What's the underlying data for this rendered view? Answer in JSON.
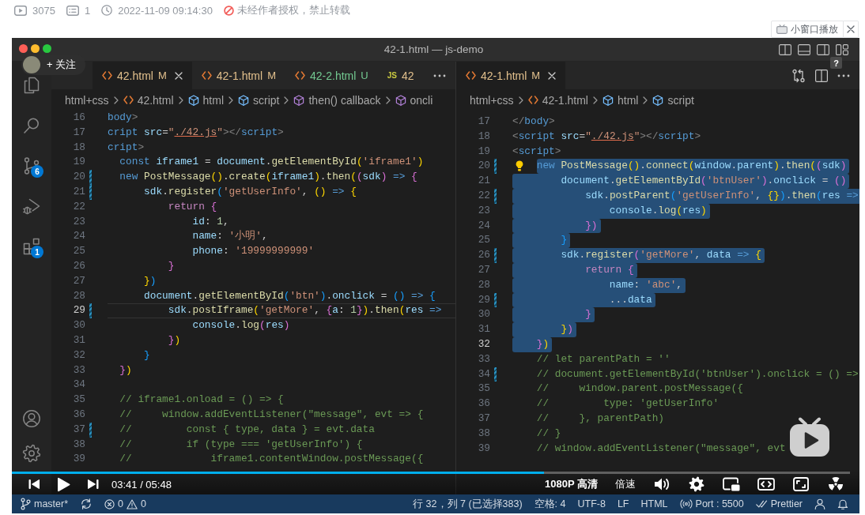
{
  "stats": {
    "plays": "3075",
    "comments": "1",
    "published": "2022-11-09 09:14:30",
    "notice": "未经作者授权，禁止转载"
  },
  "mini_player_button": {
    "label": "小窗口播放"
  },
  "video": {
    "window": {
      "title": "42-1.html — js-demo"
    },
    "follow_button": {
      "label": "+ 关注"
    },
    "help_badge": {
      "label": "?"
    },
    "activity_bar": {
      "source_control_badge": "6",
      "extensions_badge": "1"
    },
    "editors": [
      {
        "tabs": [
          {
            "label": "42.html",
            "status": "M",
            "kind": "html",
            "color": "#e2c08d",
            "selected": true
          },
          {
            "label": "42-1.html",
            "status": "M",
            "kind": "html",
            "color": "#e2c08d",
            "selected": false
          },
          {
            "label": "42-2.html",
            "status": "U",
            "kind": "html",
            "color": "#73c991",
            "selected": false
          },
          {
            "label": "42",
            "icon_text": "JS",
            "kind": "js",
            "color": "#e2c08d",
            "selected": false
          }
        ],
        "breadcrumbs": [
          {
            "label": "html+css",
            "kind": "folder"
          },
          {
            "label": "42.html",
            "kind": "file"
          },
          {
            "label": "html",
            "kind": "element"
          },
          {
            "label": "script",
            "kind": "element"
          },
          {
            "label": "then() callback",
            "kind": "method"
          },
          {
            "label": "oncli",
            "kind": "method"
          }
        ],
        "lines": [
          {
            "number": "16",
            "modified": false,
            "current": false,
            "tokens": [
              {
                "text": "body",
                "kind": "tag"
              },
              {
                "text": ">",
                "kind": "angle"
              }
            ]
          },
          {
            "number": "17",
            "modified": false,
            "current": false,
            "tokens": [
              {
                "text": "cript",
                "kind": "tag"
              },
              {
                "text": " src",
                "kind": "attr"
              },
              {
                "text": "=",
                "kind": "plain"
              },
              {
                "text": "\"",
                "kind": "string"
              },
              {
                "text": "./42.js",
                "kind": "link"
              },
              {
                "text": "\"",
                "kind": "string"
              },
              {
                "text": "></",
                "kind": "angle"
              },
              {
                "text": "script",
                "kind": "tag"
              },
              {
                "text": ">",
                "kind": "angle"
              }
            ]
          },
          {
            "number": "18",
            "modified": false,
            "current": false,
            "tokens": [
              {
                "text": "cript",
                "kind": "tag"
              },
              {
                "text": ">",
                "kind": "angle"
              }
            ]
          },
          {
            "number": "19",
            "modified": false,
            "current": false,
            "tokens": [
              {
                "text": "  const ",
                "kind": "keyword"
              },
              {
                "text": "iframe1",
                "kind": "variable"
              },
              {
                "text": " = ",
                "kind": "plain"
              },
              {
                "text": "document",
                "kind": "variable"
              },
              {
                "text": ".",
                "kind": "plain"
              },
              {
                "text": "getElementById",
                "kind": "function"
              },
              {
                "text": "(",
                "kind": "bracket1"
              },
              {
                "text": "'iframe1'",
                "kind": "string"
              },
              {
                "text": ")",
                "kind": "bracket1"
              }
            ]
          },
          {
            "number": "20",
            "modified": true,
            "current": false,
            "tokens": [
              {
                "text": "  new ",
                "kind": "keyword"
              },
              {
                "text": "PostMessage",
                "kind": "function"
              },
              {
                "text": "()",
                "kind": "bracket1"
              },
              {
                "text": ".",
                "kind": "plain"
              },
              {
                "text": "create",
                "kind": "function"
              },
              {
                "text": "(",
                "kind": "bracket1"
              },
              {
                "text": "iframe1",
                "kind": "variable"
              },
              {
                "text": ")",
                "kind": "bracket1"
              },
              {
                "text": ".",
                "kind": "plain"
              },
              {
                "text": "then",
                "kind": "function"
              },
              {
                "text": "(",
                "kind": "bracket1"
              },
              {
                "text": "(",
                "kind": "bracket2"
              },
              {
                "text": "sdk",
                "kind": "variable"
              },
              {
                "text": ")",
                "kind": "bracket2"
              },
              {
                "text": " => ",
                "kind": "keyword"
              },
              {
                "text": "{",
                "kind": "bracket2"
              }
            ]
          },
          {
            "number": "21",
            "modified": true,
            "current": false,
            "tokens": [
              {
                "text": "      sdk",
                "kind": "variable"
              },
              {
                "text": ".",
                "kind": "plain"
              },
              {
                "text": "register",
                "kind": "function"
              },
              {
                "text": "(",
                "kind": "bracket3"
              },
              {
                "text": "'getUserInfo'",
                "kind": "string"
              },
              {
                "text": ", ",
                "kind": "plain"
              },
              {
                "text": "()",
                "kind": "bracket1"
              },
              {
                "text": " => ",
                "kind": "keyword"
              },
              {
                "text": "{",
                "kind": "bracket1"
              }
            ]
          },
          {
            "number": "22",
            "modified": false,
            "current": false,
            "tokens": [
              {
                "text": "          return ",
                "kind": "control"
              },
              {
                "text": "{",
                "kind": "bracket2"
              }
            ]
          },
          {
            "number": "23",
            "modified": false,
            "current": false,
            "tokens": [
              {
                "text": "              id",
                "kind": "variable"
              },
              {
                "text": ": ",
                "kind": "plain"
              },
              {
                "text": "1",
                "kind": "number"
              },
              {
                "text": ",",
                "kind": "plain"
              }
            ]
          },
          {
            "number": "24",
            "modified": false,
            "current": false,
            "tokens": [
              {
                "text": "              name",
                "kind": "variable"
              },
              {
                "text": ": ",
                "kind": "plain"
              },
              {
                "text": "'小明'",
                "kind": "string"
              },
              {
                "text": ",",
                "kind": "plain"
              }
            ]
          },
          {
            "number": "25",
            "modified": false,
            "current": false,
            "tokens": [
              {
                "text": "              phone",
                "kind": "variable"
              },
              {
                "text": ": ",
                "kind": "plain"
              },
              {
                "text": "'19999999999'",
                "kind": "string"
              }
            ]
          },
          {
            "number": "26",
            "modified": false,
            "current": false,
            "tokens": [
              {
                "text": "          }",
                "kind": "bracket2"
              }
            ]
          },
          {
            "number": "27",
            "modified": false,
            "current": false,
            "tokens": [
              {
                "text": "      }",
                "kind": "bracket1"
              },
              {
                "text": ")",
                "kind": "bracket3"
              }
            ]
          },
          {
            "number": "28",
            "modified": false,
            "current": false,
            "tokens": [
              {
                "text": "      document",
                "kind": "variable"
              },
              {
                "text": ".",
                "kind": "plain"
              },
              {
                "text": "getElementById",
                "kind": "function"
              },
              {
                "text": "(",
                "kind": "bracket3"
              },
              {
                "text": "'btn'",
                "kind": "string"
              },
              {
                "text": ")",
                "kind": "bracket3"
              },
              {
                "text": ".",
                "kind": "plain"
              },
              {
                "text": "onclick",
                "kind": "variable"
              },
              {
                "text": " = ",
                "kind": "plain"
              },
              {
                "text": "()",
                "kind": "bracket3"
              },
              {
                "text": " => ",
                "kind": "keyword"
              },
              {
                "text": "{",
                "kind": "bracket3"
              }
            ]
          },
          {
            "number": "29",
            "modified": true,
            "current": true,
            "tokens": [
              {
                "text": "          sdk",
                "kind": "variable"
              },
              {
                "text": ".",
                "kind": "plain"
              },
              {
                "text": "postIframe",
                "kind": "function"
              },
              {
                "text": "(",
                "kind": "bracket1"
              },
              {
                "text": "'getMore'",
                "kind": "string"
              },
              {
                "text": ", ",
                "kind": "plain"
              },
              {
                "text": "{",
                "kind": "bracket2"
              },
              {
                "text": "a",
                "kind": "variable"
              },
              {
                "text": ": ",
                "kind": "plain"
              },
              {
                "text": "1",
                "kind": "number"
              },
              {
                "text": "}",
                "kind": "bracket2"
              },
              {
                "text": ")",
                "kind": "bracket1"
              },
              {
                "text": ".",
                "kind": "plain"
              },
              {
                "text": "then",
                "kind": "function"
              },
              {
                "text": "(",
                "kind": "bracket1"
              },
              {
                "text": "res",
                "kind": "variable"
              },
              {
                "text": " =>",
                "kind": "keyword"
              }
            ]
          },
          {
            "number": "30",
            "modified": false,
            "current": false,
            "tokens": [
              {
                "text": "              console",
                "kind": "variable"
              },
              {
                "text": ".",
                "kind": "plain"
              },
              {
                "text": "log",
                "kind": "function"
              },
              {
                "text": "(",
                "kind": "bracket2"
              },
              {
                "text": "res",
                "kind": "variable"
              },
              {
                "text": ")",
                "kind": "bracket2"
              }
            ]
          },
          {
            "number": "31",
            "modified": false,
            "current": false,
            "tokens": [
              {
                "text": "          }",
                "kind": "bracket2"
              },
              {
                "text": ")",
                "kind": "bracket1"
              }
            ]
          },
          {
            "number": "32",
            "modified": false,
            "current": false,
            "tokens": [
              {
                "text": "      }",
                "kind": "bracket3"
              }
            ]
          },
          {
            "number": "33",
            "modified": false,
            "current": false,
            "tokens": [
              {
                "text": "  }",
                "kind": "bracket2"
              },
              {
                "text": ")",
                "kind": "bracket1"
              }
            ]
          },
          {
            "number": "34",
            "modified": false,
            "current": false
          },
          {
            "number": "35",
            "modified": false,
            "current": false,
            "tokens": [
              {
                "text": "  // iframe1.onload = () => {",
                "kind": "comment"
              }
            ]
          },
          {
            "number": "36",
            "modified": false,
            "current": false,
            "tokens": [
              {
                "text": "  //     window.addEventListener(\"message\", evt => {",
                "kind": "comment"
              }
            ]
          },
          {
            "number": "37",
            "modified": true,
            "current": false,
            "tokens": [
              {
                "text": "  //         const { type, data } = evt.data",
                "kind": "comment"
              }
            ]
          },
          {
            "number": "38",
            "modified": false,
            "current": false,
            "tokens": [
              {
                "text": "  //         if (type === 'getUserInfo') {",
                "kind": "comment"
              }
            ]
          },
          {
            "number": "39",
            "modified": false,
            "current": false,
            "tokens": [
              {
                "text": "  //             iframe1.contentWindow.postMessage({",
                "kind": "comment"
              }
            ]
          }
        ]
      },
      {
        "tabs": [
          {
            "label": "42-1.html",
            "status": "M",
            "kind": "html",
            "color": "#e2c08d",
            "selected": true
          }
        ],
        "breadcrumbs": [
          {
            "label": "html+css",
            "kind": "folder"
          },
          {
            "label": "42-1.html",
            "kind": "file"
          },
          {
            "label": "html",
            "kind": "element"
          },
          {
            "label": "script",
            "kind": "element"
          }
        ],
        "code_action_hint": true,
        "lines": [
          {
            "number": "17",
            "modified": false,
            "current": false,
            "selected": false,
            "tokens": [
              {
                "text": "</",
                "kind": "angle"
              },
              {
                "text": "body",
                "kind": "tag"
              },
              {
                "text": ">",
                "kind": "angle"
              }
            ]
          },
          {
            "number": "18",
            "modified": false,
            "current": false,
            "selected": false,
            "tokens": [
              {
                "text": "<",
                "kind": "angle"
              },
              {
                "text": "script",
                "kind": "tag"
              },
              {
                "text": " src",
                "kind": "attr"
              },
              {
                "text": "=",
                "kind": "plain"
              },
              {
                "text": "\"",
                "kind": "string"
              },
              {
                "text": "./42.js",
                "kind": "link"
              },
              {
                "text": "\"",
                "kind": "string"
              },
              {
                "text": "></",
                "kind": "angle"
              },
              {
                "text": "script",
                "kind": "tag"
              },
              {
                "text": ">",
                "kind": "angle"
              }
            ]
          },
          {
            "number": "19",
            "modified": false,
            "current": false,
            "selected": false,
            "tokens": [
              {
                "text": "<",
                "kind": "angle"
              },
              {
                "text": "script",
                "kind": "tag"
              },
              {
                "text": ">",
                "kind": "angle"
              }
            ]
          },
          {
            "number": "20",
            "modified": true,
            "current": false,
            "selected": true,
            "tokens": [
              {
                "text": "    new ",
                "kind": "keyword"
              },
              {
                "text": "PostMessage",
                "kind": "function"
              },
              {
                "text": "()",
                "kind": "bracket1"
              },
              {
                "text": ".",
                "kind": "plain"
              },
              {
                "text": "connect",
                "kind": "function"
              },
              {
                "text": "(",
                "kind": "bracket1"
              },
              {
                "text": "window",
                "kind": "variable"
              },
              {
                "text": ".",
                "kind": "plain"
              },
              {
                "text": "parent",
                "kind": "variable"
              },
              {
                "text": ")",
                "kind": "bracket1"
              },
              {
                "text": ".",
                "kind": "plain"
              },
              {
                "text": "then",
                "kind": "function"
              },
              {
                "text": "(",
                "kind": "bracket1"
              },
              {
                "text": "(",
                "kind": "bracket2"
              },
              {
                "text": "sdk",
                "kind": "variable"
              },
              {
                "text": ")",
                "kind": "bracket2"
              }
            ]
          },
          {
            "number": "21",
            "modified": false,
            "current": false,
            "selected": true,
            "tokens": [
              {
                "text": "        document",
                "kind": "variable"
              },
              {
                "text": ".",
                "kind": "plain"
              },
              {
                "text": "getElementById",
                "kind": "function"
              },
              {
                "text": "(",
                "kind": "bracket2"
              },
              {
                "text": "'btnUser'",
                "kind": "string"
              },
              {
                "text": ")",
                "kind": "bracket2"
              },
              {
                "text": ".",
                "kind": "plain"
              },
              {
                "text": "onclick",
                "kind": "variable"
              },
              {
                "text": " = ",
                "kind": "plain"
              },
              {
                "text": "()",
                "kind": "bracket2"
              }
            ]
          },
          {
            "number": "22",
            "modified": true,
            "current": false,
            "selected": true,
            "tokens": [
              {
                "text": "            sdk",
                "kind": "variable"
              },
              {
                "text": ".",
                "kind": "plain"
              },
              {
                "text": "postParent",
                "kind": "function"
              },
              {
                "text": "(",
                "kind": "bracket3"
              },
              {
                "text": "'getUserInfo'",
                "kind": "string"
              },
              {
                "text": ", ",
                "kind": "plain"
              },
              {
                "text": "{}",
                "kind": "bracket1"
              },
              {
                "text": ")",
                "kind": "bracket3"
              },
              {
                "text": ".",
                "kind": "plain"
              },
              {
                "text": "then",
                "kind": "function"
              },
              {
                "text": "(",
                "kind": "bracket3"
              },
              {
                "text": "res",
                "kind": "variable"
              },
              {
                "text": " =>",
                "kind": "keyword"
              }
            ]
          },
          {
            "number": "23",
            "modified": false,
            "current": false,
            "selected": true,
            "tokens": [
              {
                "text": "                console",
                "kind": "variable"
              },
              {
                "text": ".",
                "kind": "plain"
              },
              {
                "text": "log",
                "kind": "function"
              },
              {
                "text": "(",
                "kind": "bracket1"
              },
              {
                "text": "res",
                "kind": "variable"
              },
              {
                "text": ")",
                "kind": "bracket1"
              }
            ]
          },
          {
            "number": "24",
            "modified": false,
            "current": false,
            "selected": true,
            "tokens": [
              {
                "text": "            }",
                "kind": "bracket2"
              },
              {
                "text": ")",
                "kind": "bracket2"
              }
            ]
          },
          {
            "number": "25",
            "modified": false,
            "current": false,
            "selected": true,
            "tokens": [
              {
                "text": "        }",
                "kind": "bracket3"
              }
            ]
          },
          {
            "number": "26",
            "modified": true,
            "current": false,
            "selected": true,
            "tokens": [
              {
                "text": "        sdk",
                "kind": "variable"
              },
              {
                "text": ".",
                "kind": "plain"
              },
              {
                "text": "register",
                "kind": "function"
              },
              {
                "text": "(",
                "kind": "bracket2"
              },
              {
                "text": "'getMore'",
                "kind": "string"
              },
              {
                "text": ", ",
                "kind": "plain"
              },
              {
                "text": "data",
                "kind": "variable"
              },
              {
                "text": " => ",
                "kind": "keyword"
              },
              {
                "text": "{",
                "kind": "bracket1"
              }
            ]
          },
          {
            "number": "27",
            "modified": false,
            "current": false,
            "selected": true,
            "tokens": [
              {
                "text": "            return ",
                "kind": "control"
              },
              {
                "text": "{",
                "kind": "bracket2"
              }
            ]
          },
          {
            "number": "28",
            "modified": false,
            "current": false,
            "selected": true,
            "tokens": [
              {
                "text": "                name",
                "kind": "variable"
              },
              {
                "text": ": ",
                "kind": "plain"
              },
              {
                "text": "'abc'",
                "kind": "string"
              },
              {
                "text": ",",
                "kind": "plain"
              }
            ]
          },
          {
            "number": "29",
            "modified": true,
            "current": false,
            "selected": true,
            "tokens": [
              {
                "text": "                ...",
                "kind": "plain"
              },
              {
                "text": "data",
                "kind": "variable"
              }
            ]
          },
          {
            "number": "30",
            "modified": false,
            "current": false,
            "selected": true,
            "tokens": [
              {
                "text": "            }",
                "kind": "bracket2"
              }
            ]
          },
          {
            "number": "31",
            "modified": false,
            "current": false,
            "selected": true,
            "tokens": [
              {
                "text": "        }",
                "kind": "bracket1"
              },
              {
                "text": ")",
                "kind": "bracket2"
              }
            ]
          },
          {
            "number": "32",
            "modified": false,
            "current": true,
            "selected": true,
            "tokens": [
              {
                "text": "    }",
                "kind": "bracket2"
              },
              {
                "text": ")",
                "kind": "bracket1"
              }
            ]
          },
          {
            "number": "33",
            "modified": false,
            "current": false,
            "selected": false,
            "tokens": [
              {
                "text": "    // let parentPath = ''",
                "kind": "comment"
              }
            ]
          },
          {
            "number": "34",
            "modified": true,
            "current": false,
            "selected": false,
            "tokens": [
              {
                "text": "    // document.getElementById('btnUser').onclick = () =>",
                "kind": "comment"
              }
            ]
          },
          {
            "number": "35",
            "modified": false,
            "current": false,
            "selected": false,
            "tokens": [
              {
                "text": "    //     window.parent.postMessage({",
                "kind": "comment"
              }
            ]
          },
          {
            "number": "36",
            "modified": false,
            "current": false,
            "selected": false,
            "tokens": [
              {
                "text": "    //         type: 'getUserInfo'",
                "kind": "comment"
              }
            ]
          },
          {
            "number": "37",
            "modified": false,
            "current": false,
            "selected": false,
            "tokens": [
              {
                "text": "    //     }, parentPath)",
                "kind": "comment"
              }
            ]
          },
          {
            "number": "38",
            "modified": false,
            "current": false,
            "selected": false,
            "tokens": [
              {
                "text": "    // }",
                "kind": "comment"
              }
            ]
          },
          {
            "number": "39",
            "modified": false,
            "current": false,
            "selected": false,
            "tokens": [
              {
                "text": "    // window.addEventListener(\"message\", evt",
                "kind": "comment"
              }
            ]
          }
        ]
      }
    ],
    "status_bar": {
      "branch": "master*",
      "errors": "0",
      "warnings": "0",
      "cursor_position": "行 32，列 7 (已选择383)",
      "indentation": "空格: 4",
      "encoding": "UTF-8",
      "line_ending": "LF",
      "language": "HTML",
      "live_server": "Port : 5500",
      "formatter": "Prettier"
    },
    "player": {
      "paused": true,
      "progress": {
        "level": 0.635
      },
      "time": "03:41 / 05:48",
      "quality": "1080P 高清",
      "speed": "倍速"
    }
  }
}
